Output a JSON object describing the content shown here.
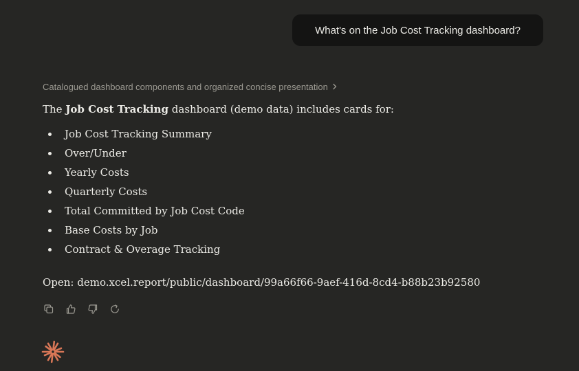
{
  "user_message": "What's on the Job Cost Tracking dashboard?",
  "thinking_summary": "Catalogued dashboard components and organized concise presentation",
  "response": {
    "intro_prefix": "The",
    "intro_bold": "Job Cost Tracking",
    "intro_suffix": "dashboard (demo data) includes cards for:",
    "cards": [
      "Job Cost Tracking Summary",
      "Over/Under",
      "Yearly Costs",
      "Quarterly Costs",
      "Total Committed by Job Cost Code",
      "Base Costs by Job",
      "Contract & Overage Tracking"
    ],
    "open_label": "Open:",
    "open_url": "demo.xcel.report/public/dashboard/99a66f66-9aef-416d-8cd4-b88b23b92580"
  },
  "actions": {
    "copy_icon": "copy-icon",
    "thumbs_up_icon": "thumbs-up-icon",
    "thumbs_down_icon": "thumbs-down-icon",
    "retry_icon": "retry-icon"
  },
  "colors": {
    "background": "#262624",
    "user_bubble": "#141413",
    "text": "#ecebe6",
    "muted": "#9c9a92",
    "brand": "#d97757"
  }
}
